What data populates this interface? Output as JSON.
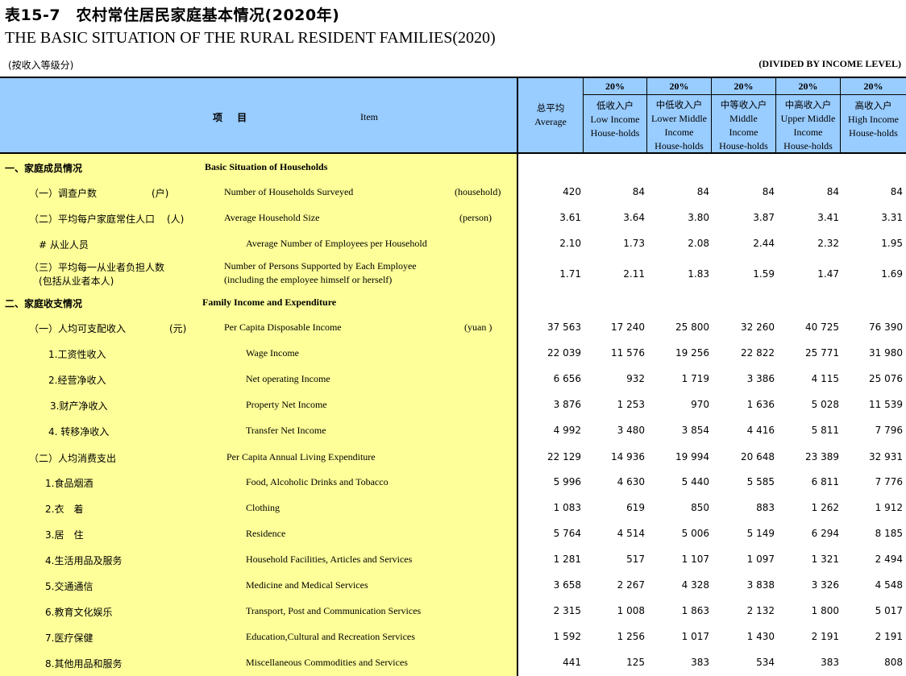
{
  "header": {
    "title_cn": "表15-7　农村常住居民家庭基本情况(2020年)",
    "title_en": "THE BASIC SITUATION OF THE RURAL RESIDENT FAMILIES(2020)",
    "note_cn": "(按收入等级分)",
    "note_en": "(DIVIDED BY INCOME LEVEL)"
  },
  "table_header": {
    "item_cn": "项 目",
    "item_en": "Item",
    "average_cn": "总平均",
    "average_en": "Average",
    "groups": [
      {
        "pct": "20%",
        "l1": "低收入户",
        "l2": "Low Income",
        "l3": "House-holds"
      },
      {
        "pct": "20%",
        "l1": "中低收入户",
        "l2": "Lower Middle",
        "l3": "Income",
        "l4": "House-holds"
      },
      {
        "pct": "20%",
        "l1": "中等收入户",
        "l2": "Middle",
        "l3": "Income",
        "l4": "House-holds"
      },
      {
        "pct": "20%",
        "l1": "中高收入户",
        "l2": "Upper Middle",
        "l3": "Income",
        "l4": "House-holds"
      },
      {
        "pct": "20%",
        "l1": "高收入户",
        "l2": "High Income",
        "l3": "House-holds"
      }
    ]
  },
  "rows": [
    {
      "cn": "一、家庭成员情况",
      "en": "Basic Situation of Households",
      "values": [
        "",
        "",
        "",
        "",
        "",
        ""
      ]
    },
    {
      "cn": "（一）调查户数",
      "unit_cn": "(户)",
      "en": "Number of Households Surveyed",
      "unit_en": "(household)",
      "values": [
        "420",
        "84",
        "84",
        "84",
        "84",
        "84"
      ]
    },
    {
      "cn": "（二）平均每户家庭常住人口",
      "unit_cn": "(人)",
      "en": "Average Household Size",
      "unit_en": "(person)",
      "values": [
        "3.61",
        "3.64",
        "3.80",
        "3.87",
        "3.41",
        "3.31"
      ]
    },
    {
      "cn": "# 从业人员",
      "en": "Average Number of Employees per Household",
      "values": [
        "2.10",
        "1.73",
        "2.08",
        "2.44",
        "2.32",
        "1.95"
      ]
    },
    {
      "cn": "（三）平均每一从业者负担人数",
      "cn2": "(包括从业者本人)",
      "en": "Number of Persons Supported by Each Employee",
      "en2": "(including the employee himself or herself)",
      "values": [
        "1.71",
        "2.11",
        "1.83",
        "1.59",
        "1.47",
        "1.69"
      ]
    },
    {
      "cn": "二、家庭收支情况",
      "en": "Family Income and Expenditure",
      "values": [
        "",
        "",
        "",
        "",
        "",
        ""
      ]
    },
    {
      "cn": "（一）人均可支配收入",
      "unit_cn": "(元)",
      "en": "Per Capita Disposable Income",
      "unit_en": "(yuan )",
      "values": [
        "37 563",
        "17 240",
        "25 800",
        "32 260",
        "40 725",
        "76 390"
      ]
    },
    {
      "cn": "1.工资性收入",
      "en": "Wage Income",
      "values": [
        "22 039",
        "11 576",
        "19 256",
        "22 822",
        "25 771",
        "31 980"
      ]
    },
    {
      "cn": "2.经营净收入",
      "en": "Net operating Income",
      "values": [
        "6 656",
        "932",
        "1 719",
        "3 386",
        "4 115",
        "25 076"
      ]
    },
    {
      "cn": "3.财产净收入",
      "en": "Property Net Income",
      "values": [
        "3 876",
        "1 253",
        "970",
        "1 636",
        "5 028",
        "11 539"
      ]
    },
    {
      "cn": "4. 转移净收入",
      "en": "Transfer Net Income",
      "values": [
        "4 992",
        "3 480",
        "3 854",
        "4 416",
        "5 811",
        "7 796"
      ]
    },
    {
      "cn": "（二）人均消费支出",
      "en": "Per Capita Annual Living Expenditure",
      "values": [
        "22 129",
        "14 936",
        "19 994",
        "20 648",
        "23 389",
        "32 931"
      ]
    },
    {
      "cn": "1.食品烟酒",
      "en": "Food, Alcoholic Drinks and Tobacco",
      "values": [
        "5 996",
        "4 630",
        "5 440",
        "5 585",
        "6 811",
        "7 776"
      ]
    },
    {
      "cn": "2.衣　着",
      "en": "Clothing",
      "values": [
        "1 083",
        "619",
        "850",
        "883",
        "1 262",
        "1 912"
      ]
    },
    {
      "cn": "3.居　住",
      "en": "Residence",
      "values": [
        "5 764",
        "4 514",
        "5 006",
        "5 149",
        "6 294",
        "8 185"
      ]
    },
    {
      "cn": "4.生活用品及服务",
      "en": "Household Facilities, Articles and Services",
      "values": [
        "1 281",
        "517",
        "1 107",
        "1 097",
        "1 321",
        "2 494"
      ]
    },
    {
      "cn": "5.交通通信",
      "en": "Medicine and Medical Services",
      "values": [
        "3 658",
        "2 267",
        "4 328",
        "3 838",
        "3 326",
        "4 548"
      ]
    },
    {
      "cn": "6.教育文化娱乐",
      "en": "Transport, Post and Communication Services",
      "values": [
        "2 315",
        "1 008",
        "1 863",
        "2 132",
        "1 800",
        "5 017"
      ]
    },
    {
      "cn": "7.医疗保健",
      "en": "Education,Cultural and Recreation Services",
      "values": [
        "1 592",
        "1 256",
        "1 017",
        "1 430",
        "2 191",
        "2 191"
      ]
    },
    {
      "cn": "8.其他用品和服务",
      "en": "Miscellaneous Commodities and Services",
      "values": [
        "441",
        "125",
        "383",
        "534",
        "383",
        "808"
      ]
    }
  ]
}
